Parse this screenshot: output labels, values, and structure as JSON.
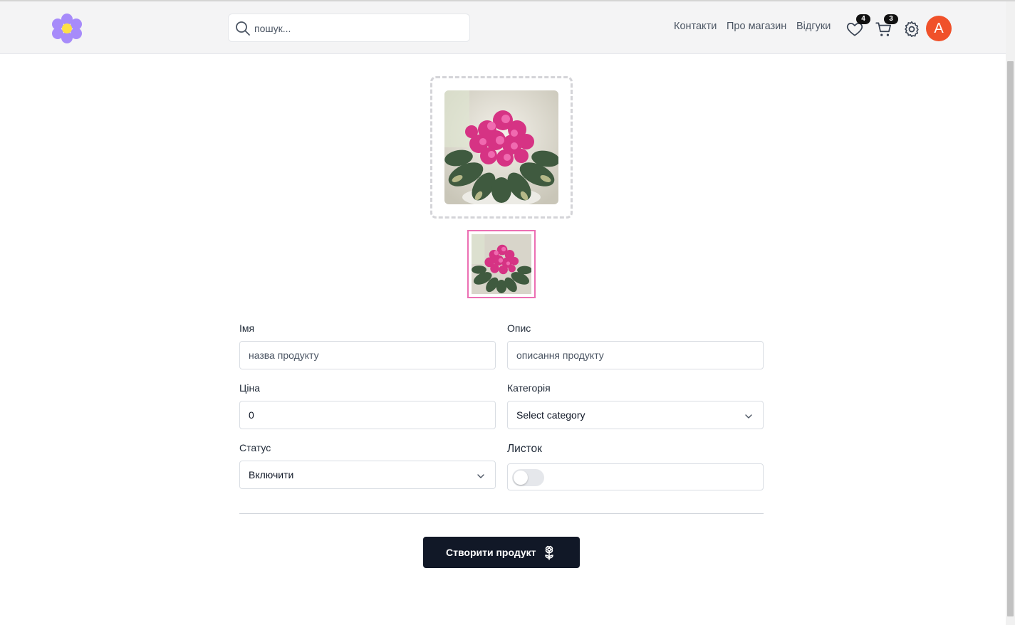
{
  "header": {
    "search_placeholder": "пошук...",
    "nav": [
      {
        "label": "Контакти"
      },
      {
        "label": "Про магазин"
      },
      {
        "label": "Відгуки"
      }
    ],
    "favorites_count": "4",
    "cart_count": "3",
    "avatar_letter": "A"
  },
  "form": {
    "name_label": "Імя",
    "name_placeholder": "назва продукту",
    "description_label": "Опис",
    "description_placeholder": "описання продукту",
    "price_label": "Ціна",
    "price_value": "0",
    "category_label": "Категорія",
    "category_selected": "Select category",
    "status_label": "Статус",
    "status_selected": "Включити",
    "leaf_label": "Листок",
    "leaf_enabled": false,
    "submit_label": "Створити продукт"
  },
  "colors": {
    "avatar": "#f0512a",
    "primary_button": "#111827",
    "thumb_border": "#ec6fb3",
    "logo_petals": "#a78bfa",
    "logo_center": "#fde047"
  },
  "icons": [
    "flower-logo-icon",
    "search-icon",
    "heart-icon",
    "cart-icon",
    "gear-icon",
    "chevron-down-icon",
    "flower-icon"
  ]
}
